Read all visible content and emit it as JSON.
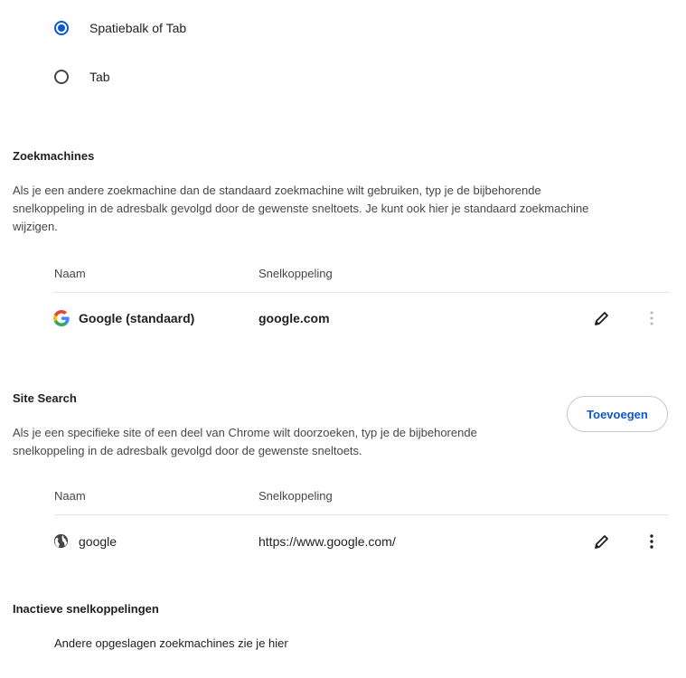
{
  "shortcut_options": {
    "option_space_or_tab": {
      "label": "Spatiebalk of Tab",
      "selected": true
    },
    "option_tab": {
      "label": "Tab",
      "selected": false
    }
  },
  "search_engines": {
    "title": "Zoekmachines",
    "description_line1": "Als je een andere zoekmachine dan de standaard zoekmachine wilt gebruiken, typ je de bijbehorende",
    "description_line2": "snelkoppeling in de adresbalk gevolgd door de gewenste sneltoets. Je kunt ook hier je standaard zoekmachine",
    "description_line3": "wijzigen.",
    "col_name": "Naam",
    "col_shortcut": "Snelkoppeling",
    "rows": [
      {
        "name": "Google (standaard)",
        "shortcut": "google.com",
        "icon": "google-g-icon"
      }
    ]
  },
  "site_search": {
    "title": "Site Search",
    "add_button": "Toevoegen",
    "description_line1": "Als je een specifieke site of een deel van Chrome wilt doorzoeken, typ je de bijbehorende",
    "description_line2": "snelkoppeling in de adresbalk gevolgd door de gewenste sneltoets.",
    "col_name": "Naam",
    "col_shortcut": "Snelkoppeling",
    "rows": [
      {
        "name": "google",
        "shortcut": "https://www.google.com/",
        "icon": "globe-icon"
      }
    ]
  },
  "inactive_shortcuts": {
    "title": "Inactieve snelkoppelingen",
    "description": "Andere opgeslagen zoekmachines zie je hier"
  },
  "colors": {
    "accent": "#0b57d0",
    "text": "#1f1f1f",
    "secondary_text": "#474747",
    "divider": "#e3e3e3"
  }
}
